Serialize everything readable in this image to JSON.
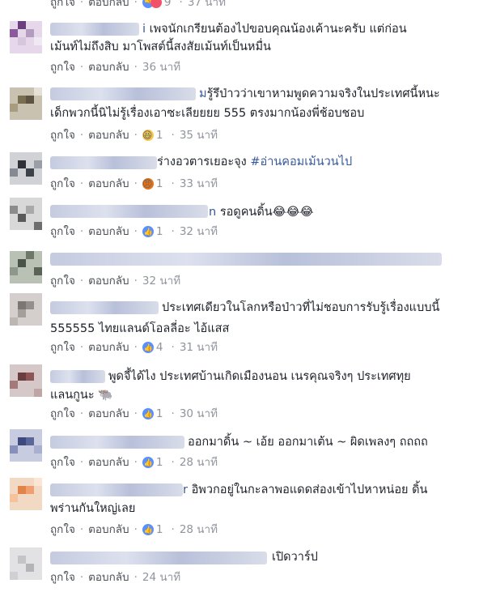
{
  "actions": {
    "like": "ถูกใจ",
    "reply": "ตอบกลับ",
    "sep": "·"
  },
  "top_fragment": {
    "count": "9",
    "time": "37 นาที"
  },
  "comments": [
    {
      "name_suffix": "i",
      "line1": "เพจนักเกรียนต้องไปขอบคุณน้องเค้านะครับ แต่ก่อน",
      "line2": "เม้นท์ไม่ถึงสิบ มาโพสต์นี้สงสัยเม้นท์เป็นหมื่น",
      "reaction": "",
      "count": "",
      "time": "36 นาที"
    },
    {
      "name_suffix": "ม",
      "line1": "รู้รึป่าวว่าเขาหามพูดความจริงในประเทศนี้หนะ",
      "line2": "เด็กพวกนี้นิไม่รู้เรื่องเอาซะเลียยยย 555 ตรงมากน้องพี่ช้อบชอบ",
      "reaction": "haha",
      "count": "1",
      "time": "35 นาที"
    },
    {
      "name_suffix": "",
      "line1": "ร่างอวตารเยอะจุง",
      "hashtag": "#อ่านคอมเม้นวนไป",
      "line2": "",
      "reaction": "angry",
      "count": "1",
      "time": "33 นาที"
    },
    {
      "name_suffix": "n",
      "line1": "รอดูคนดิ้น😂😂😂",
      "line2": "",
      "reaction": "like",
      "count": "1",
      "time": "32 นาที"
    },
    {
      "name_suffix": "",
      "line1": "",
      "line2": "",
      "reaction": "",
      "count": "",
      "time": "32 นาที"
    },
    {
      "name_suffix": "",
      "line1": "ประเทศเดียวในโลกหรือป่าวที่ไม่ชอบการรับรู้เรื่องแบบนี้",
      "line2": "555555 ไทยแลนด์โอลลี่อะ ไอ้แสส",
      "reaction": "like",
      "count": "4",
      "time": "31 นาที"
    },
    {
      "name_suffix": "",
      "line1": "พูดจี้ได้ไง ประเทศบ้านเกิดเมืองนอน เนรคุณจริงๆ ประเทศทุย",
      "line2": "แลนกูนะ 🐃",
      "reaction": "like",
      "count": "1",
      "time": "30 นาที"
    },
    {
      "name_suffix": "",
      "line1": "ออกมาดิ้น ~ เอ้ย ออกมาเต้น ~ ผิดเพลงๆ ถถถถ",
      "line2": "",
      "reaction": "like",
      "count": "1",
      "time": "28 นาที"
    },
    {
      "name_suffix": "r",
      "line1": "อิพวกอยู่ในกะลาพอแดดส่องเข้าไปหาหน่อย ดิ้น",
      "line2": "พร่านกันใหญ่เลย",
      "reaction": "like",
      "count": "1",
      "time": "28 นาที"
    },
    {
      "name_suffix": "",
      "line1": "เปิดวาร์ป",
      "line2": "",
      "reaction": "",
      "count": "",
      "time": "24 นาที"
    }
  ]
}
